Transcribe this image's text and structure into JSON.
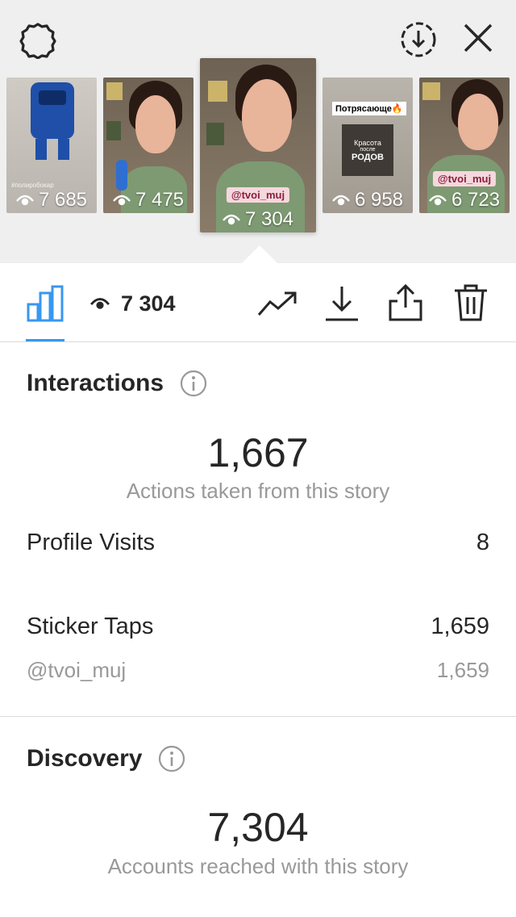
{
  "stories": [
    {
      "views": "7 685",
      "label": "#полиробокар"
    },
    {
      "views": "7 475"
    },
    {
      "views": "7 304",
      "tag": "@tvoi_muj",
      "selected": true
    },
    {
      "views": "6 958",
      "badge": "Потрясающе🔥",
      "title_line1": "Красота",
      "title_line2": "после",
      "title_line3": "РОДОВ"
    },
    {
      "views": "6 723",
      "tag": "@tvoi_muj"
    }
  ],
  "toolbar": {
    "views": "7 304"
  },
  "interactions": {
    "title": "Interactions",
    "total": "1,667",
    "caption": "Actions taken from this story",
    "profile_visits_label": "Profile Visits",
    "profile_visits_value": "8",
    "sticker_taps_label": "Sticker Taps",
    "sticker_taps_value": "1,659",
    "sticker_handle": "@tvoi_muj",
    "sticker_handle_value": "1,659"
  },
  "discovery": {
    "title": "Discovery",
    "total": "7,304",
    "caption": "Accounts reached with this story"
  },
  "colors": {
    "accent": "#3897f0",
    "text": "#262626",
    "muted": "#999999",
    "strip": "#efefef"
  }
}
